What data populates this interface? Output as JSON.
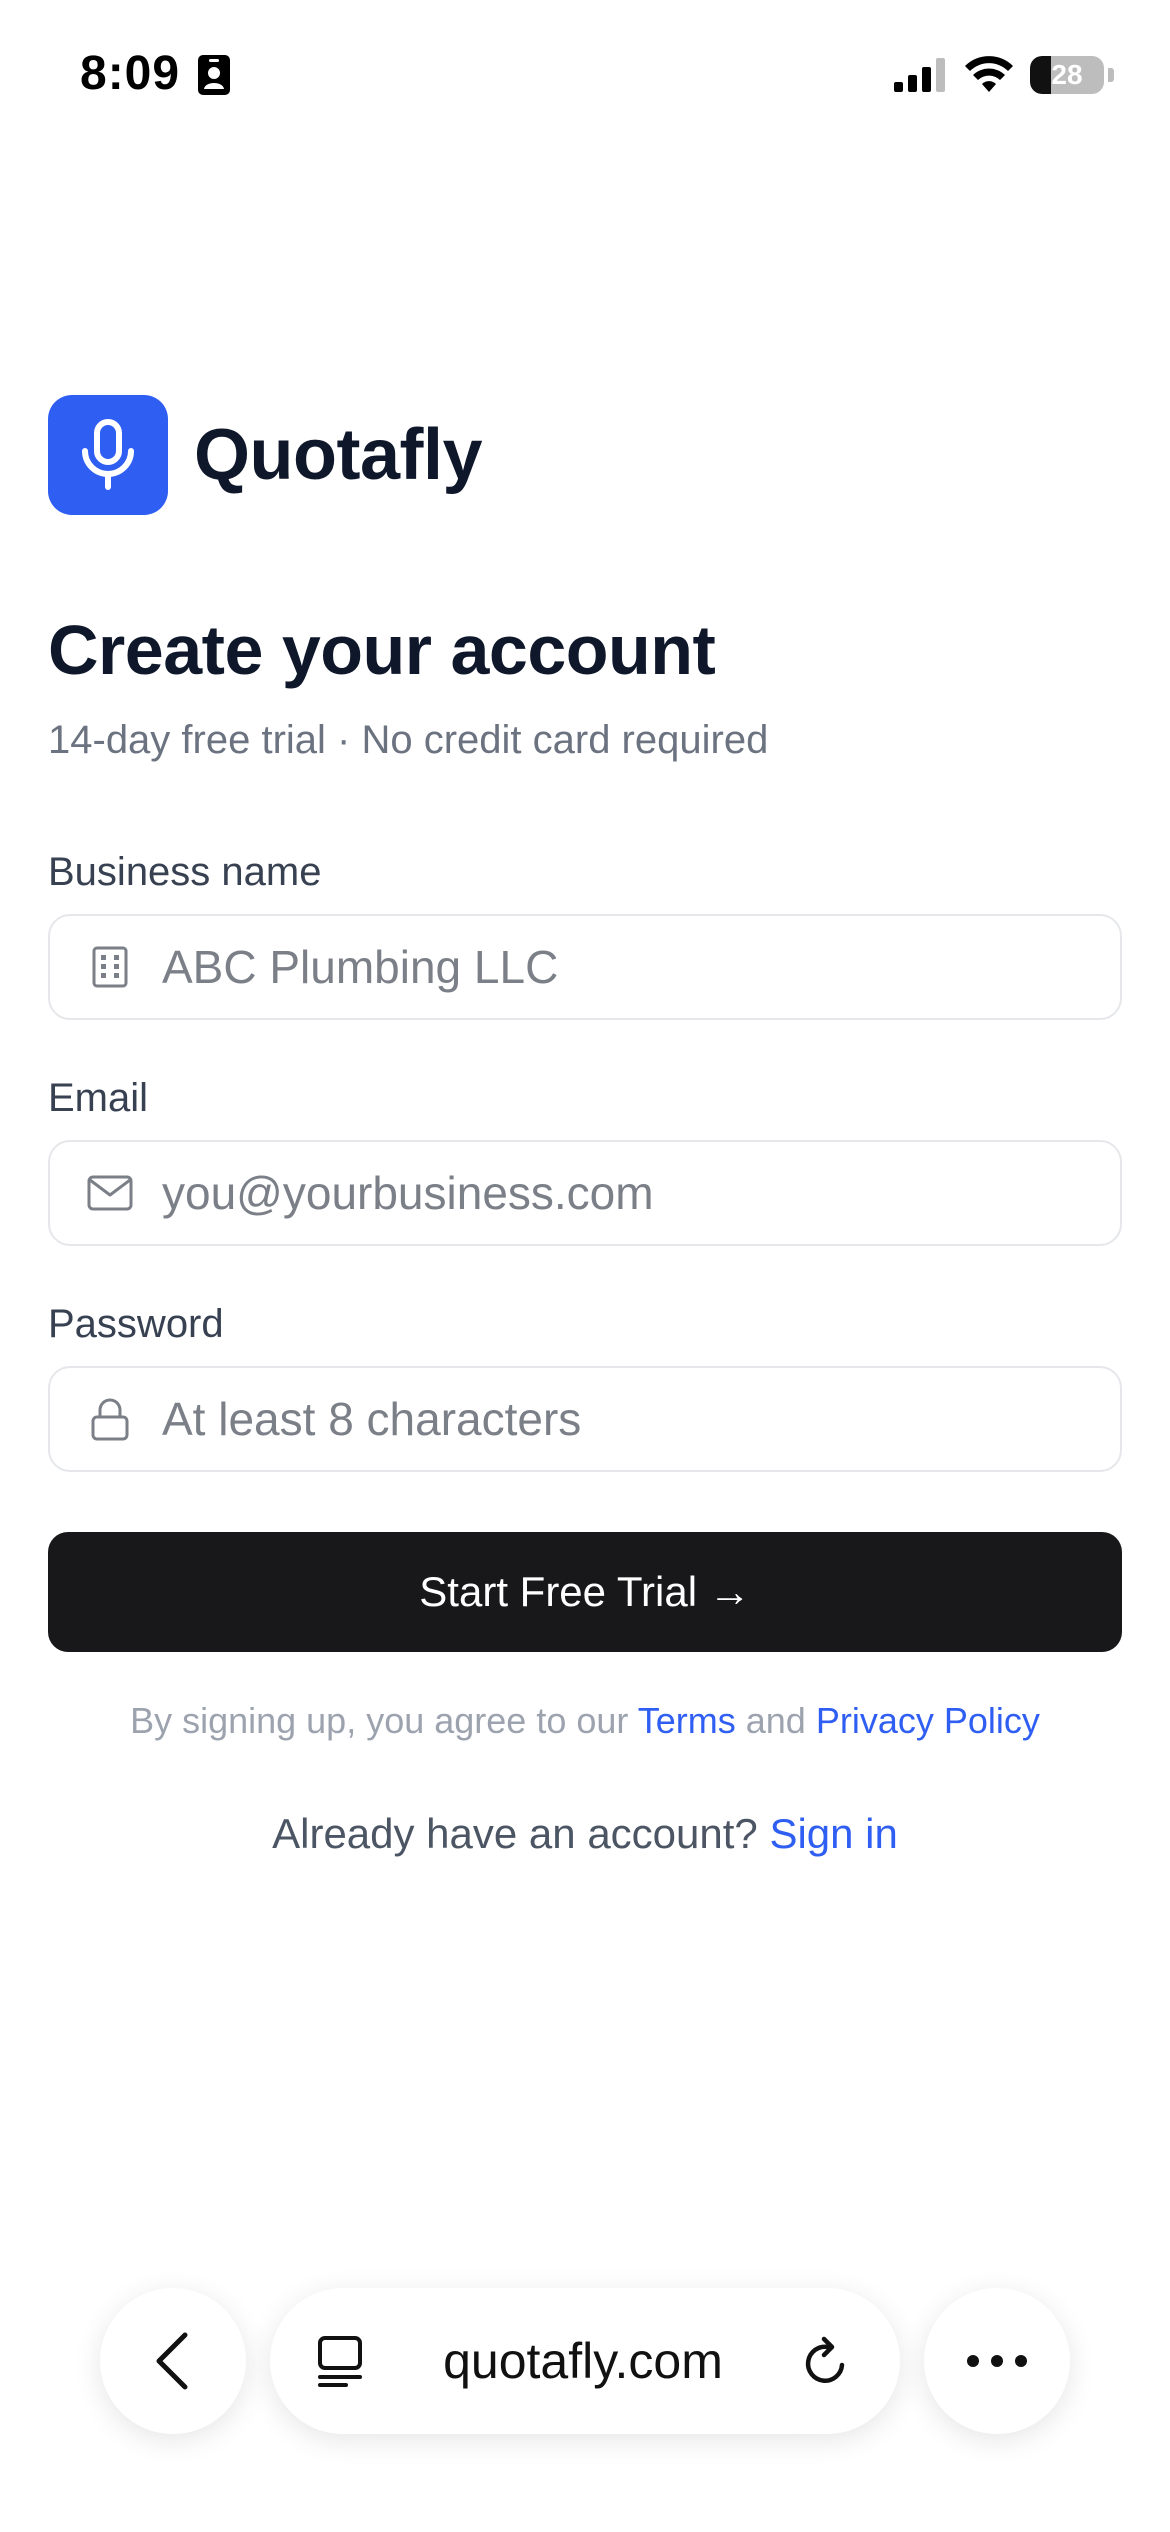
{
  "status_bar": {
    "time": "8:09",
    "battery_level": "28",
    "battery_fraction": 0.28
  },
  "brand": {
    "name": "Quotafly",
    "logo_icon": "microphone-icon",
    "accent_color": "#2f5ef3"
  },
  "heading": {
    "title": "Create your account",
    "subtitle": "14-day free trial · No credit card required"
  },
  "form": {
    "business_name": {
      "label": "Business name",
      "placeholder": "ABC Plumbing LLC",
      "icon": "building-icon"
    },
    "email": {
      "label": "Email",
      "placeholder": "you@yourbusiness.com",
      "icon": "mail-icon"
    },
    "password": {
      "label": "Password",
      "placeholder": "At least 8 characters",
      "icon": "lock-icon"
    },
    "submit_label": "Start Free Trial →"
  },
  "legal": {
    "prefix": "By signing up, you agree to our",
    "terms": "Terms",
    "and": "and",
    "privacy": "Privacy Policy"
  },
  "signin": {
    "prompt": "Already have an account?",
    "link": "Sign in"
  },
  "browser": {
    "url": "quotafly.com"
  }
}
